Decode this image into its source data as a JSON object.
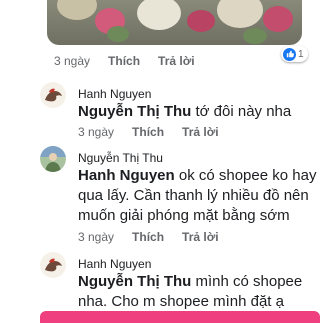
{
  "comments": [
    {
      "meta": {
        "time": "3 ngày",
        "like": "Thích",
        "reply": "Trả lời"
      },
      "reaction_count": "1"
    },
    {
      "author": "Hanh Nguyen",
      "mention": "Nguyễn Thị Thu",
      "text": " tớ đôi này nha",
      "meta": {
        "time": "3 ngày",
        "like": "Thích",
        "reply": "Trả lời"
      }
    },
    {
      "author": "Nguyễn Thị Thu",
      "mention": "Hanh Nguyen",
      "text_line1": " ok có shopee ko hay",
      "text_line2": "qua lấy. Cần thanh lý nhiều đồ nên",
      "text_line3": "muốn giải phóng mặt bằng sớm",
      "meta": {
        "time": "3 ngày",
        "like": "Thích",
        "reply": "Trả lời"
      }
    },
    {
      "author": "Hanh Nguyen",
      "mention": "Nguyễn Thị Thu",
      "text_line1": " mình có shopee",
      "text_line2": "nha. Cho m shopee mình đặt ạ"
    }
  ],
  "colors": {
    "accent": "#1877f2",
    "bottom_bar": "#f03f7e",
    "meta_text": "#65676b"
  }
}
